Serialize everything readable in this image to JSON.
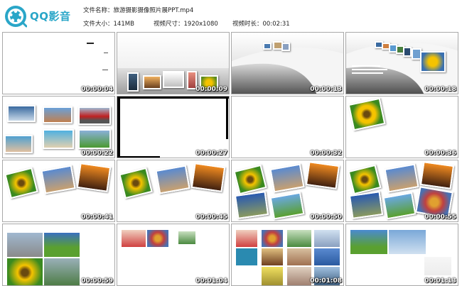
{
  "app": {
    "logo_text": "QQ影音"
  },
  "file_info": {
    "name_label": "文件名称：",
    "name_value": "旅游摄影摄像照片展PPT.mp4",
    "size_label": "文件大小：",
    "size_value": "141MB",
    "dims_label": "视频尺寸：",
    "dims_value": "1920x1080",
    "duration_label": "视频时长：",
    "duration_value": "00:02:31"
  },
  "thumbnails": [
    {
      "timestamp": "00:00:04"
    },
    {
      "timestamp": "00:00:09"
    },
    {
      "timestamp": "00:00:13"
    },
    {
      "timestamp": "00:00:18"
    },
    {
      "timestamp": "00:00:22"
    },
    {
      "timestamp": "00:00:27"
    },
    {
      "timestamp": "00:00:32"
    },
    {
      "timestamp": "00:00:36"
    },
    {
      "timestamp": "00:00:41"
    },
    {
      "timestamp": "00:00:45"
    },
    {
      "timestamp": "00:00:50"
    },
    {
      "timestamp": "00:00:55"
    },
    {
      "timestamp": "00:00:59"
    },
    {
      "timestamp": "00:01:04"
    },
    {
      "timestamp": "00:01:08"
    },
    {
      "timestamp": "00:01:13"
    }
  ],
  "colors": {
    "brand": "#2aa6c8",
    "border": "#a9a9a9",
    "timestamp": "#ffffff"
  }
}
